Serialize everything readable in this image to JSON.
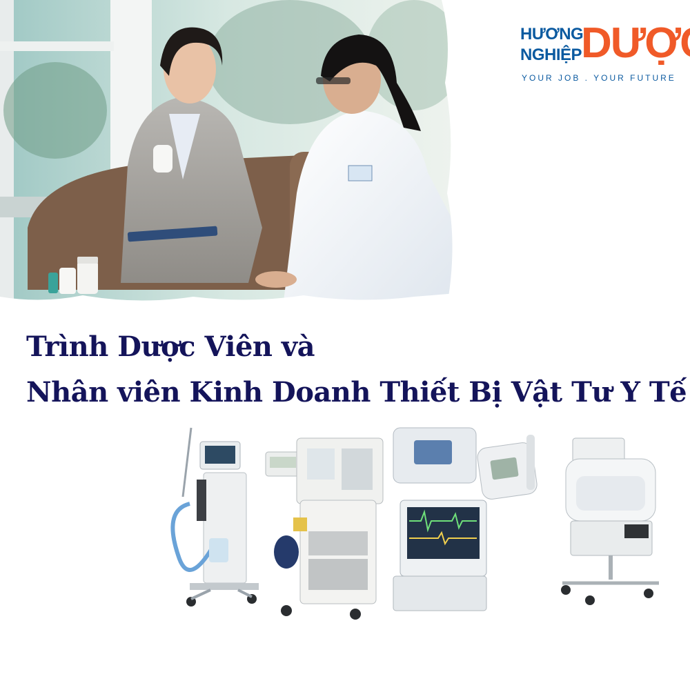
{
  "logo": {
    "word_1": "HƯƠNG",
    "word_2": "NGHIỆP",
    "big_word": "DƯỢC",
    "tagline": "YOUR JOB . YOUR FUTURE",
    "colors": {
      "blue": "#0b5aa0",
      "orange": "#f05a28"
    }
  },
  "heading": {
    "line_1": "Trình Dược Viên và",
    "line_2": "Nhân viên Kinh Doanh Thiết Bị Vật Tư Y Tế",
    "color": "#14145a"
  },
  "images": {
    "photo": "pharma-rep-meeting-doctor-photo",
    "equipment": "medical-equipment-collage"
  }
}
